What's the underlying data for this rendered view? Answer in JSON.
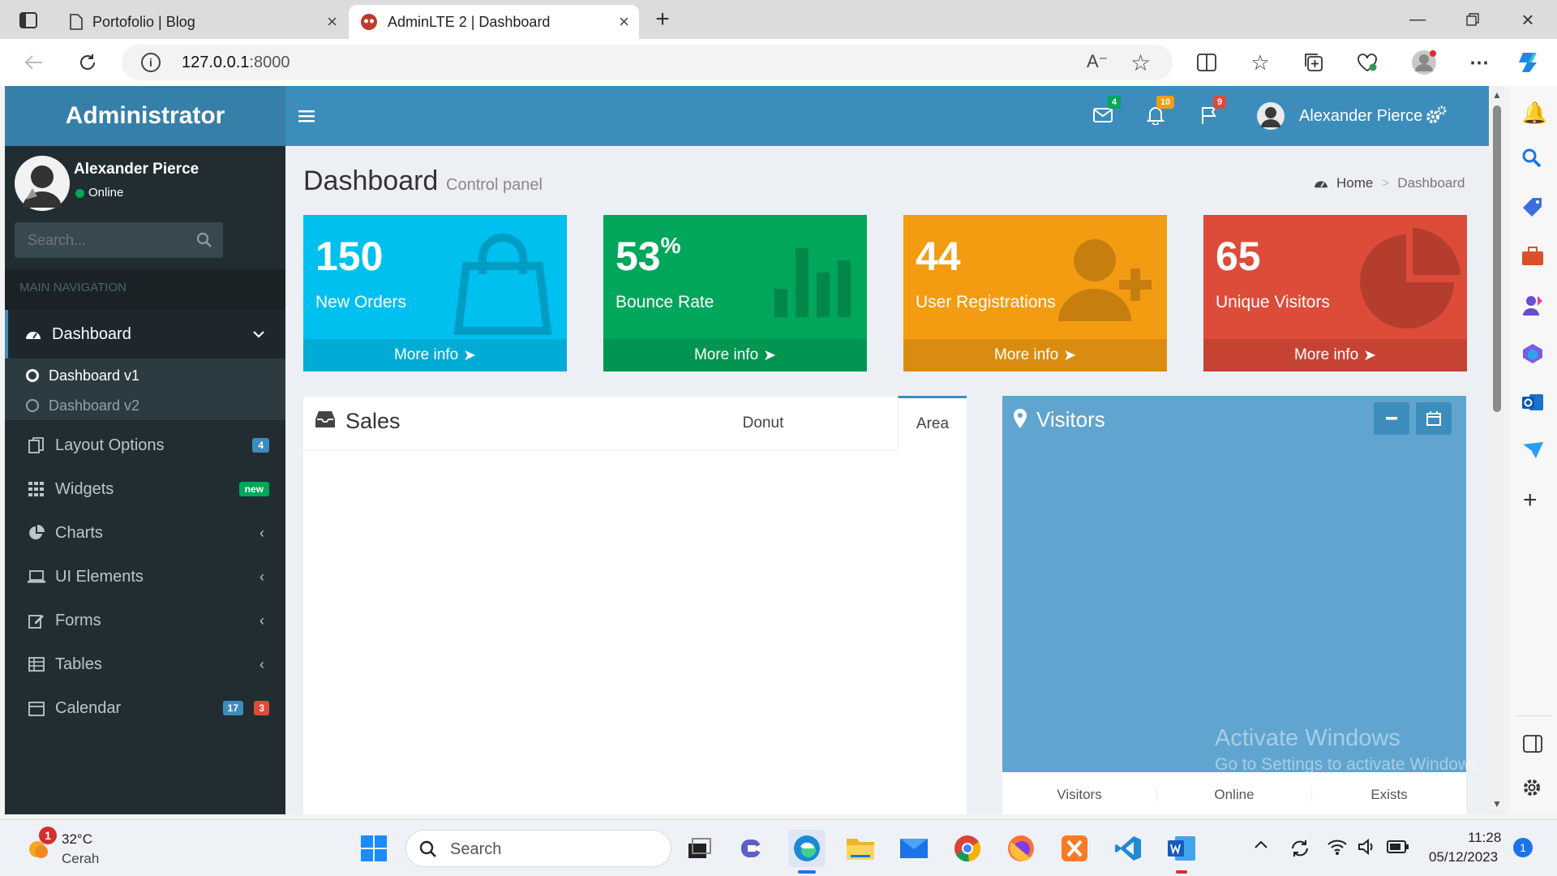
{
  "browser": {
    "tabs": [
      {
        "title": "Portofolio | Blog",
        "active": false
      },
      {
        "title": "AdminLTE 2 | Dashboard",
        "active": true
      }
    ],
    "url_host": "127.0.0.1",
    "url_port": ":8000"
  },
  "app": {
    "logo": "Administrator",
    "navbar": {
      "messages_count": "4",
      "notifications_count": "10",
      "tasks_count": "9",
      "user_name": "Alexander Pierce"
    }
  },
  "sidebar": {
    "user_name": "Alexander Pierce",
    "status": "Online",
    "search_placeholder": "Search...",
    "header": "MAIN NAVIGATION",
    "menu": [
      {
        "label": "Dashboard"
      },
      {
        "label": "Layout Options",
        "badge": "4"
      },
      {
        "label": "Widgets",
        "badge": "new"
      },
      {
        "label": "Charts"
      },
      {
        "label": "UI Elements"
      },
      {
        "label": "Forms"
      },
      {
        "label": "Tables"
      },
      {
        "label": "Calendar",
        "badges": [
          "17",
          "3"
        ]
      }
    ],
    "submenu": [
      {
        "label": "Dashboard v1"
      },
      {
        "label": "Dashboard v2"
      }
    ]
  },
  "content": {
    "title": "Dashboard",
    "subtitle": "Control panel",
    "breadcrumb": [
      "Home",
      "Dashboard"
    ],
    "boxes": [
      {
        "value": "150",
        "label": "New Orders",
        "footer": "More info",
        "color": "#00c0ef"
      },
      {
        "value": "53",
        "suffix": "%",
        "label": "Bounce Rate",
        "footer": "More info",
        "color": "#00a65a"
      },
      {
        "value": "44",
        "label": "User Registrations",
        "footer": "More info",
        "color": "#f39c12"
      },
      {
        "value": "65",
        "label": "Unique Visitors",
        "footer": "More info",
        "color": "#dd4b39"
      }
    ],
    "sales": {
      "title": "Sales",
      "tabs": [
        "Donut",
        "Area"
      ],
      "active_tab": "Area"
    },
    "visitors": {
      "title": "Visitors",
      "footer": [
        "Visitors",
        "Online",
        "Exists"
      ]
    },
    "watermark": {
      "line1": "Activate Windows",
      "line2": "Go to Settings to activate Windows."
    }
  },
  "taskbar": {
    "weather_temp": "32°C",
    "weather_desc": "Cerah",
    "weather_badge": "1",
    "search": "Search",
    "time": "11:28",
    "date": "05/12/2023",
    "notif_count": "1"
  },
  "colors": {
    "primary": "#3c8dbc",
    "sidebar": "#222d32",
    "aqua": "#00c0ef",
    "green": "#00a65a",
    "yellow": "#f39c12",
    "red": "#dd4b39"
  }
}
